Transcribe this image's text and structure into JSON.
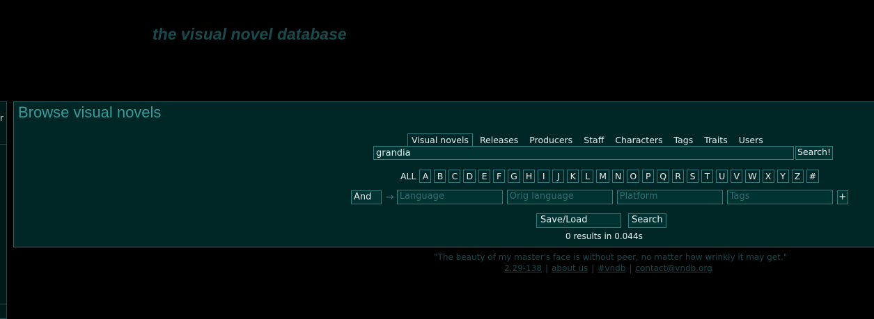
{
  "site": {
    "logo": "the visual novel database"
  },
  "left_menu": {
    "fragment": "r"
  },
  "page": {
    "title": "Browse visual novels"
  },
  "tabs": [
    {
      "label": "Visual novels",
      "active": true
    },
    {
      "label": "Releases"
    },
    {
      "label": "Producers"
    },
    {
      "label": "Staff"
    },
    {
      "label": "Characters"
    },
    {
      "label": "Tags"
    },
    {
      "label": "Traits"
    },
    {
      "label": "Users"
    }
  ],
  "search": {
    "value": "grandia",
    "button": "Search!"
  },
  "letters": {
    "all": "ALL",
    "items": [
      "A",
      "B",
      "C",
      "D",
      "E",
      "F",
      "G",
      "H",
      "I",
      "J",
      "K",
      "L",
      "M",
      "N",
      "O",
      "P",
      "Q",
      "R",
      "S",
      "T",
      "U",
      "V",
      "W",
      "X",
      "Y",
      "Z",
      "#"
    ]
  },
  "filters": {
    "and": "And",
    "arrow": "→",
    "language": "Language",
    "orig_language": "Orig language",
    "platform": "Platform",
    "tags": "Tags",
    "plus": "+"
  },
  "actions": {
    "saveload": "Save/Load",
    "search": "Search"
  },
  "results": "0 results in 0.044s",
  "footer": {
    "quote": "\"The beauty of my master's face is without peer, no matter how wrinkly it may get.\"",
    "version": "2.29-138",
    "about": "about us",
    "irc": "#vndb",
    "contact": "contact@vndb.org",
    "separator": "|"
  }
}
